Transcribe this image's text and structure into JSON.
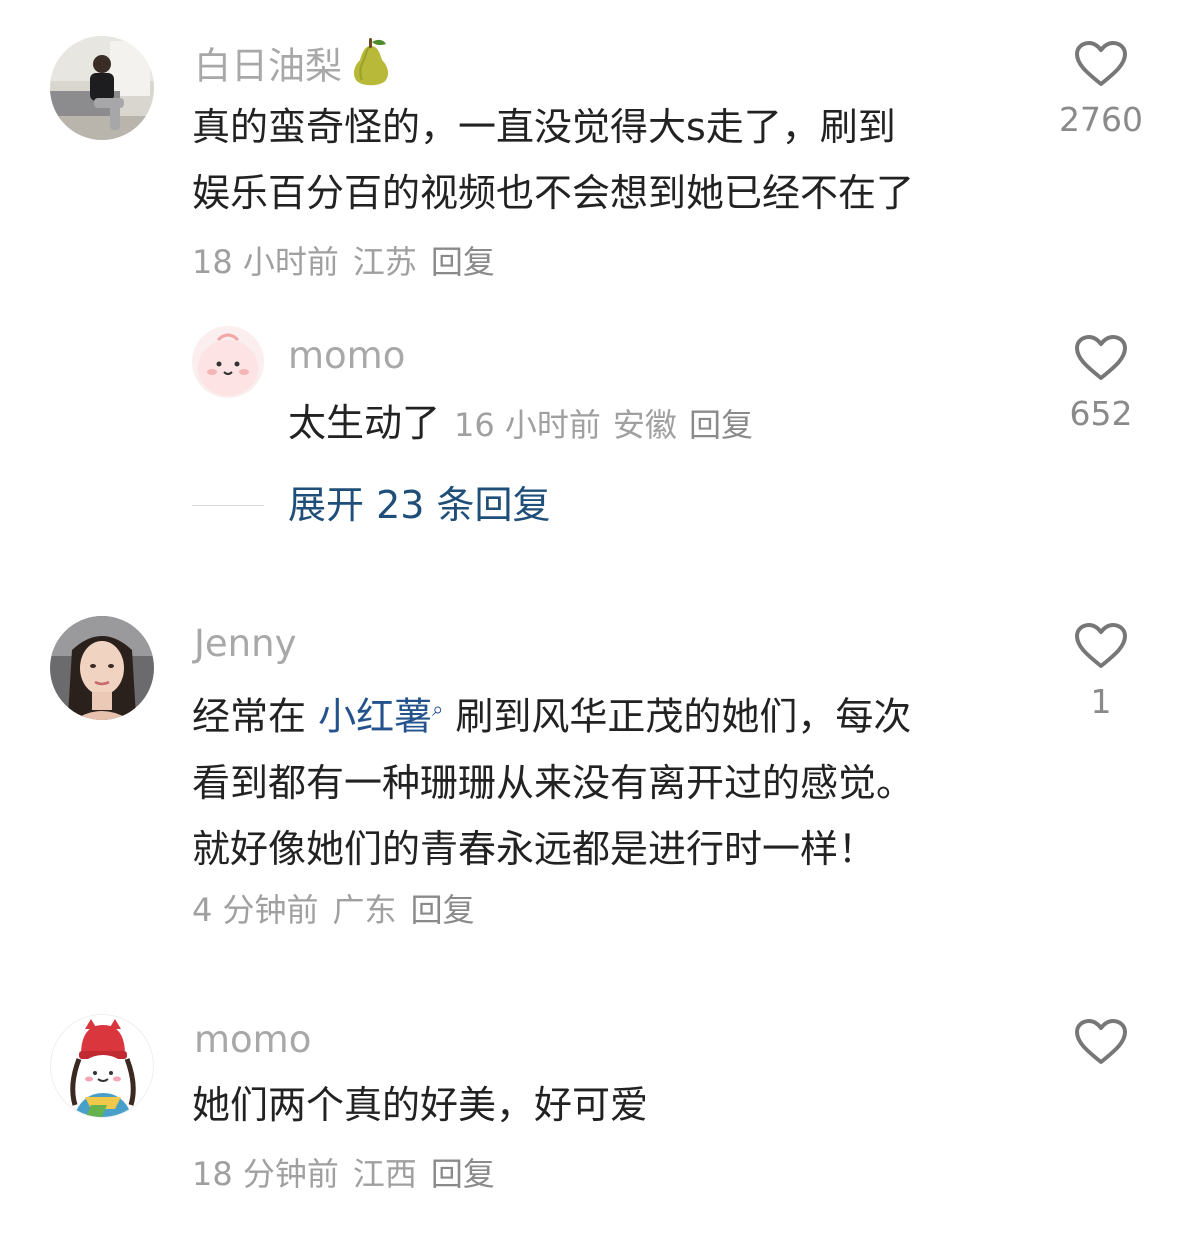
{
  "comments": [
    {
      "username": "白日油梨",
      "username_emoji": "pear-emoji",
      "lines": [
        "真的蛮奇怪的，一直没觉得大s走了，刷到",
        "娱乐百分百的视频也不会想到她已经不在了"
      ],
      "time": "18 小时前",
      "location": "江苏",
      "reply_label": "回复",
      "likes": "2760"
    },
    {
      "username": "momo",
      "text": "太生动了",
      "time": "16 小时前",
      "location": "安徽",
      "reply_label": "回复",
      "likes": "652"
    },
    {
      "username": "Jenny",
      "line1_prefix": "经常在 ",
      "line1_link": "小红薯",
      "line1_suffix": " 刷到风华正茂的她们，每次",
      "line2": "看到都有一种珊珊从来没有离开过的感觉。",
      "line3": "就好像她们的青春永远都是进行时一样！",
      "time": "4 分钟前",
      "location": "广东",
      "reply_label": "回复",
      "likes": "1"
    },
    {
      "username": "momo",
      "text": "她们两个真的好美，好可爱",
      "time": "18 分钟前",
      "location": "江西",
      "reply_label": "回复",
      "likes": ""
    }
  ],
  "expand_replies": "展开 23 条回复",
  "icons": {
    "like": "heart-outline-icon",
    "search_mark": "search-icon"
  },
  "colors": {
    "username": "#a8a8a8",
    "link": "#24528c",
    "meta": "#a0a0a0",
    "heart": "#777777"
  }
}
